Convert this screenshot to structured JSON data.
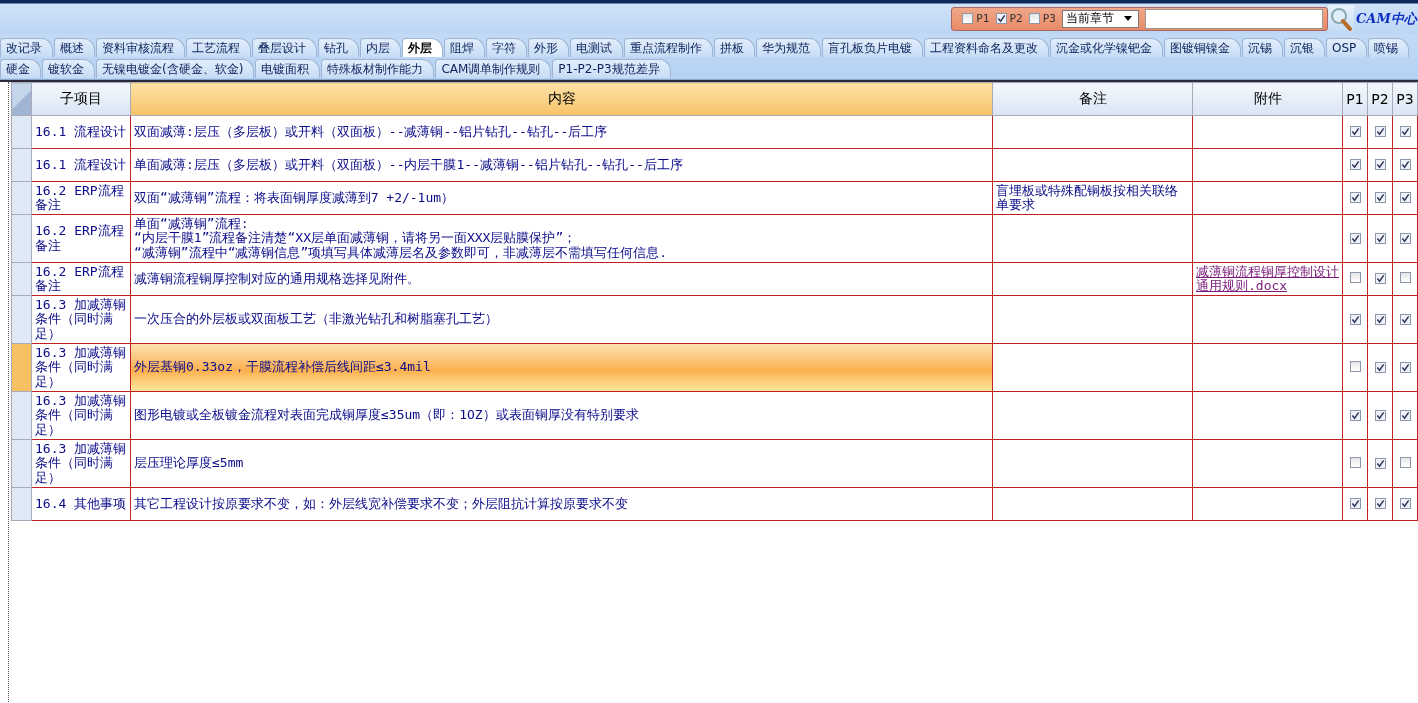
{
  "filter": {
    "options": [
      {
        "label": "P1",
        "checked": false
      },
      {
        "label": "P2",
        "checked": true
      },
      {
        "label": "P3",
        "checked": false
      }
    ],
    "dropdown": "当前章节"
  },
  "logo": "CAM中心",
  "tab_rows": [
    [
      {
        "label": "改记录",
        "selected": false
      },
      {
        "label": "概述",
        "selected": false
      },
      {
        "label": "资料审核流程",
        "selected": false
      },
      {
        "label": "工艺流程",
        "selected": false
      },
      {
        "label": "叠层设计",
        "selected": false
      },
      {
        "label": "钻孔",
        "selected": false
      },
      {
        "label": "内层",
        "selected": false
      },
      {
        "label": "外层",
        "selected": true
      },
      {
        "label": "阻焊",
        "selected": false
      },
      {
        "label": "字符",
        "selected": false
      },
      {
        "label": "外形",
        "selected": false
      },
      {
        "label": "电测试",
        "selected": false
      },
      {
        "label": "重点流程制作",
        "selected": false
      },
      {
        "label": "拼板",
        "selected": false
      },
      {
        "label": "华为规范",
        "selected": false
      },
      {
        "label": "盲孔板负片电镀",
        "selected": false
      },
      {
        "label": "工程资料命名及更改",
        "selected": false
      },
      {
        "label": "沉金或化学镍钯金",
        "selected": false
      },
      {
        "label": "图镀铜镍金",
        "selected": false
      },
      {
        "label": "沉锡",
        "selected": false
      },
      {
        "label": "沉银",
        "selected": false
      },
      {
        "label": "OSP",
        "selected": false
      },
      {
        "label": "喷锡",
        "selected": false
      }
    ],
    [
      {
        "label": "硬金",
        "selected": false
      },
      {
        "label": "镀软金",
        "selected": false
      },
      {
        "label": "无镍电镀金(含硬金、软金)",
        "selected": false
      },
      {
        "label": "电镀面积",
        "selected": false
      },
      {
        "label": "特殊板材制作能力",
        "selected": false
      },
      {
        "label": "CAM调单制作规则",
        "selected": false
      },
      {
        "label": "P1-P2-P3规范差异",
        "selected": false
      }
    ]
  ],
  "table": {
    "columns": [
      "子项目",
      "内容",
      "备注",
      "附件",
      "P1",
      "P2",
      "P3"
    ],
    "rows": [
      {
        "selected": false,
        "sub": "16.1 流程设计",
        "content": "双面减薄:层压（多层板）或开料（双面板）--减薄铜--铝片钻孔--钻孔--后工序",
        "p1": true,
        "p2": true,
        "p3": true
      },
      {
        "selected": false,
        "sub": "16.1 流程设计",
        "content": "单面减薄:层压（多层板）或开料（双面板）--内层干膜1--减薄铜--铝片钻孔--钻孔--后工序",
        "p1": true,
        "p2": true,
        "p3": true
      },
      {
        "selected": false,
        "sub": "16.2 ERP流程备注",
        "content": "双面“减薄铜”流程：将表面铜厚度减薄到7 +2/-1um）",
        "note": "盲埋板或特殊配铜板按相关联络单要求",
        "p1": true,
        "p2": true,
        "p3": true
      },
      {
        "selected": false,
        "sub": "16.2 ERP流程备注",
        "content": "单面“减薄铜”流程:\n“内层干膜1”流程备注清楚“XX层单面减薄铜，请将另一面XXX层贴膜保护”；\n“减薄铜”流程中“减薄铜信息”项填写具体减薄层名及参数即可，非减薄层不需填写任何信息.",
        "p1": true,
        "p2": true,
        "p3": true
      },
      {
        "selected": false,
        "sub": "16.2 ERP流程备注",
        "content": "减薄铜流程铜厚控制对应的通用规格选择见附件。",
        "attachment": "减薄铜流程铜厚控制设计通用规则.docx",
        "p1": false,
        "p2": true,
        "p3": false
      },
      {
        "selected": false,
        "sub": "16.3 加减薄铜条件（同时满足）",
        "content": "一次压合的外层板或双面板工艺（非激光钻孔和树脂塞孔工艺）",
        "p1": true,
        "p2": true,
        "p3": true
      },
      {
        "selected": true,
        "sub": "16.3 加减薄铜条件（同时满足）",
        "content": "外层基铜0.33oz，干膜流程补偿后线间距≤3.4mil",
        "p1": false,
        "p2": true,
        "p3": true
      },
      {
        "selected": false,
        "sub": "16.3 加减薄铜条件（同时满足）",
        "content": "图形电镀或全板镀金流程对表面完成铜厚度≤35um（即：1OZ）或表面铜厚没有特别要求",
        "p1": true,
        "p2": true,
        "p3": true
      },
      {
        "selected": false,
        "sub": "16.3 加减薄铜条件（同时满足）",
        "content": "层压理论厚度≤5mm",
        "p1": false,
        "p2": true,
        "p3": false
      },
      {
        "selected": false,
        "sub": "16.4 其他事项",
        "content": "其它工程设计按原要求不变，如：外层线宽补偿要求不变；外层阻抗计算按原要求不变",
        "p1": true,
        "p2": true,
        "p3": true
      }
    ]
  }
}
